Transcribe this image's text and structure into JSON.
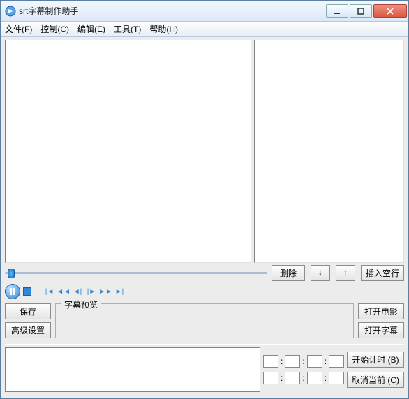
{
  "window": {
    "title": "srt字幕制作助手"
  },
  "menu": {
    "file": "文件(F)",
    "control": "控制(C)",
    "edit": "编辑(E)",
    "tools": "工具(T)",
    "help": "帮助(H)"
  },
  "buttons": {
    "delete": "删除",
    "move_down": "↓",
    "move_up": "↑",
    "insert_blank": "插入空行",
    "save": "保存",
    "advanced": "高级设置",
    "open_movie": "打开电影",
    "open_subtitle": "打开字幕",
    "start_timer": "开始计时 (B)",
    "cancel_current": "取消当前 (C)"
  },
  "labels": {
    "preview": "字幕预览"
  },
  "timecode": {
    "row1": [
      "",
      "",
      "",
      ""
    ],
    "row2": [
      "",
      "",
      "",
      ""
    ]
  }
}
